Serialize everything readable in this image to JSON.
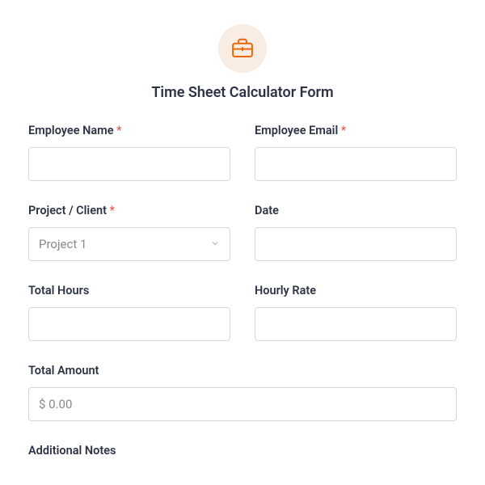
{
  "title": "Time Sheet Calculator Form",
  "fields": {
    "employee_name": {
      "label": "Employee Name",
      "required": true
    },
    "employee_email": {
      "label": "Employee Email",
      "required": true
    },
    "project_client": {
      "label": "Project / Client",
      "required": true,
      "selected": "Project 1"
    },
    "date": {
      "label": "Date"
    },
    "total_hours": {
      "label": "Total Hours"
    },
    "hourly_rate": {
      "label": "Hourly Rate"
    },
    "total_amount": {
      "label": "Total Amount",
      "value": "$ 0.00"
    },
    "additional_notes": {
      "label": "Additional Notes"
    }
  },
  "required_marker": "*"
}
